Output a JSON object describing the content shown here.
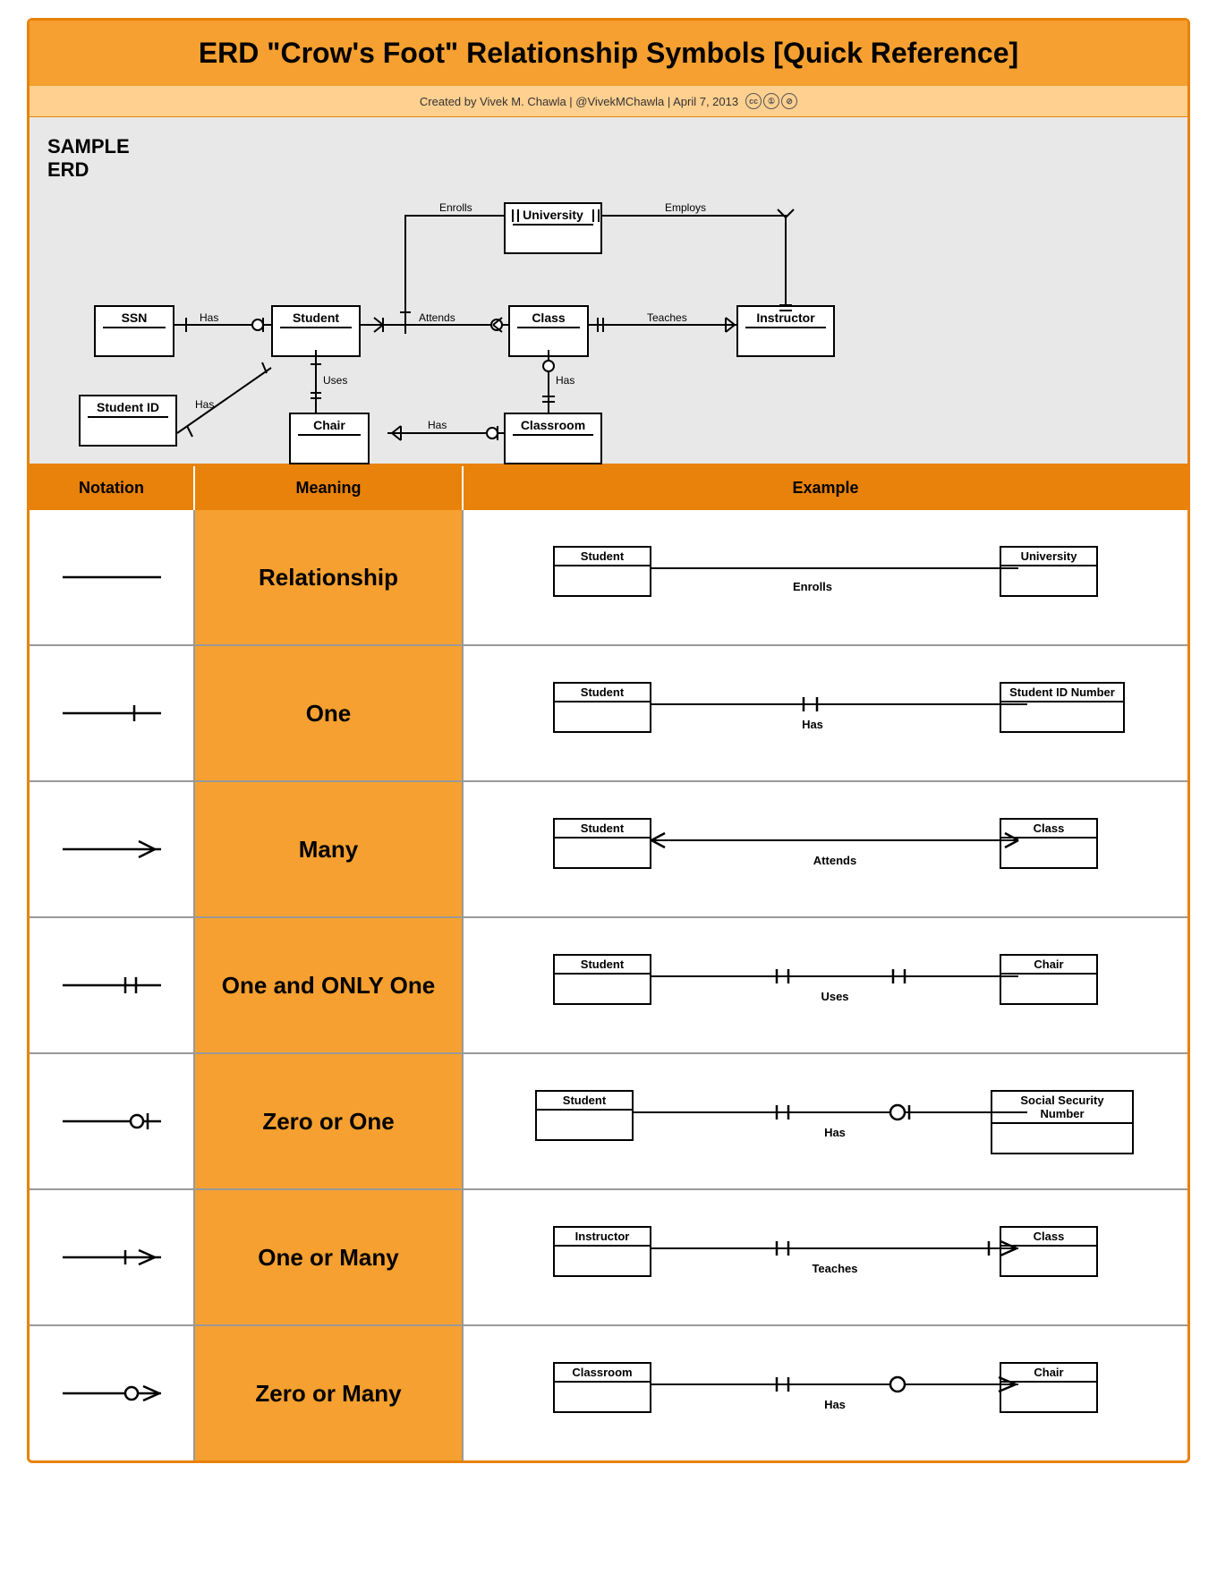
{
  "page": {
    "title": "ERD \"Crow's Foot\" Relationship Symbols [Quick Reference]",
    "subtitle": "Created by Vivek M. Chawla  |  @VivekMChawla  |  April 7, 2013",
    "erd_label": "SAMPLE\nERD",
    "table_headers": [
      "Notation",
      "Meaning",
      "Example"
    ],
    "rows": [
      {
        "meaning": "Relationship",
        "ex_left": "Student",
        "ex_right": "University",
        "ex_rel": "Enrolls",
        "type": "relationship"
      },
      {
        "meaning": "One",
        "ex_left": "Student",
        "ex_right": "Student ID Number",
        "ex_rel": "Has",
        "type": "one"
      },
      {
        "meaning": "Many",
        "ex_left": "Student",
        "ex_right": "Class",
        "ex_rel": "Attends",
        "type": "many"
      },
      {
        "meaning": "One and ONLY One",
        "ex_left": "Student",
        "ex_right": "Chair",
        "ex_rel": "Uses",
        "type": "one-only"
      },
      {
        "meaning": "Zero or One",
        "ex_left": "Student",
        "ex_right": "Social Security Number",
        "ex_rel": "Has",
        "type": "zero-or-one"
      },
      {
        "meaning": "One or Many",
        "ex_left": "Instructor",
        "ex_right": "Class",
        "ex_rel": "Teaches",
        "type": "one-or-many"
      },
      {
        "meaning": "Zero or Many",
        "ex_left": "Classroom",
        "ex_right": "Chair",
        "ex_rel": "Has",
        "type": "zero-or-many"
      }
    ]
  }
}
